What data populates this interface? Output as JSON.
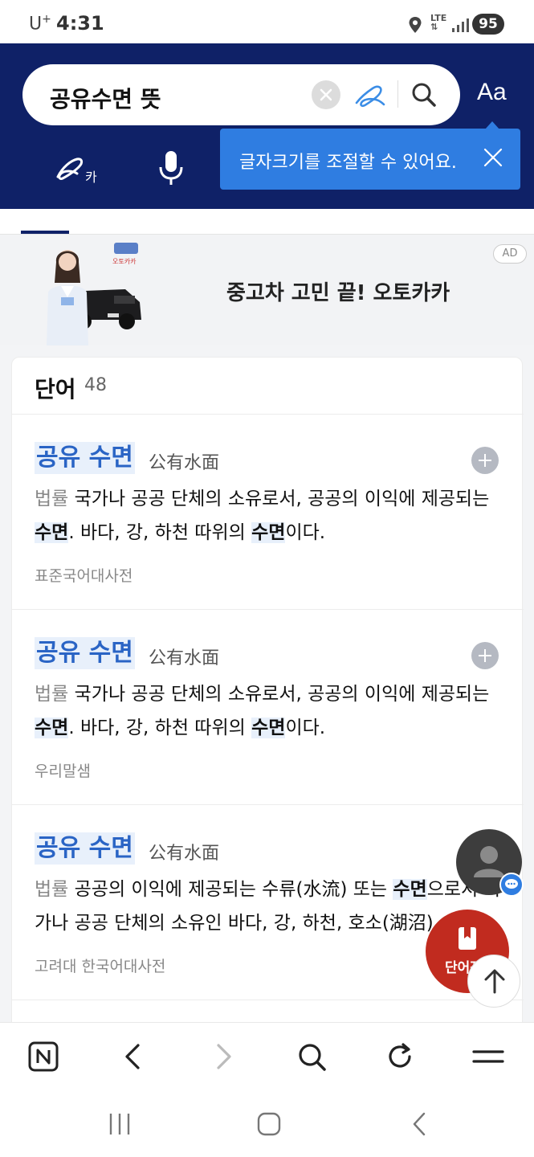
{
  "status_bar": {
    "carrier": "U",
    "carrier_sup": "+",
    "time": "4:31",
    "network": "LTE",
    "battery": "95"
  },
  "search": {
    "query": "공유수면 뜻",
    "font_size_label": "Aa",
    "tooltip": "글자크기를 조절할 수 있어요.",
    "handwrite_kana_glyph": "카"
  },
  "ad": {
    "brand": "오토카카",
    "text": "중고차 고민 끝! 오토카카",
    "badge": "AD"
  },
  "words": {
    "title": "단어",
    "count": "48",
    "entries": [
      {
        "word": "공유 수면",
        "hanja": "公有水面",
        "tag": "법률",
        "def_1": " 국가나 공공 단체의 소유로서, 공공의 이익에 제공되는 ",
        "hl_1": "수면",
        "def_2": ". 바다, 강, 하천 따위의 ",
        "hl_2": "수면",
        "def_3": "이다.",
        "source": "표준국어대사전"
      },
      {
        "word": "공유 수면",
        "hanja": "公有水面",
        "tag": "법률",
        "def_1": " 국가나 공공 단체의 소유로서, 공공의 이익에 제공되는 ",
        "hl_1": "수면",
        "def_2": ". 바다, 강, 하천 따위의 ",
        "hl_2": "수면",
        "def_3": "이다.",
        "source": "우리말샘"
      },
      {
        "word": "공유 수면",
        "hanja": "公有水面",
        "tag": "법률",
        "def_1": " 공공의 이익에 제공되는 수류(水流) 또는 ",
        "hl_1": "수면",
        "def_2": "으로서 국가나 공공 단체의 소유인 바다, 강, 하천, 호소(湖沼)",
        "hl_2": "",
        "def_3": "",
        "source": "고려대 한국어대사전"
      }
    ]
  },
  "floating": {
    "words_label": "단어장"
  },
  "colors": {
    "header": "#0f2167",
    "accent": "#2f7de1",
    "highlight_word": "#2a64c5",
    "fab_red": "#c12b1f"
  }
}
